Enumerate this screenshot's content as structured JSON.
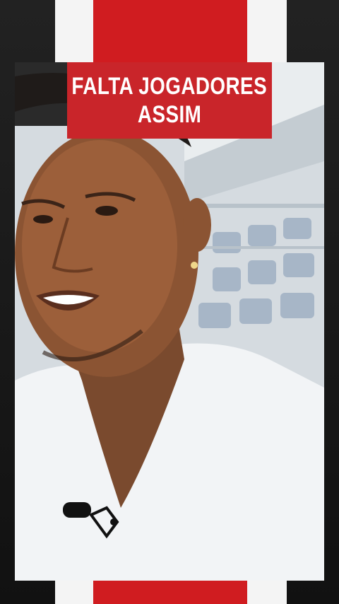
{
  "caption": {
    "line1": "FALTA JOGADORES",
    "line2": "ASSIM"
  },
  "colors": {
    "red": "#d01c20",
    "caption_bg": "#c9252a",
    "white": "#f4f4f4",
    "black": "#151515"
  },
  "video": {
    "subject": "man-in-white-shirt-interview",
    "mic_icon": "lavalier-mic-icon"
  }
}
